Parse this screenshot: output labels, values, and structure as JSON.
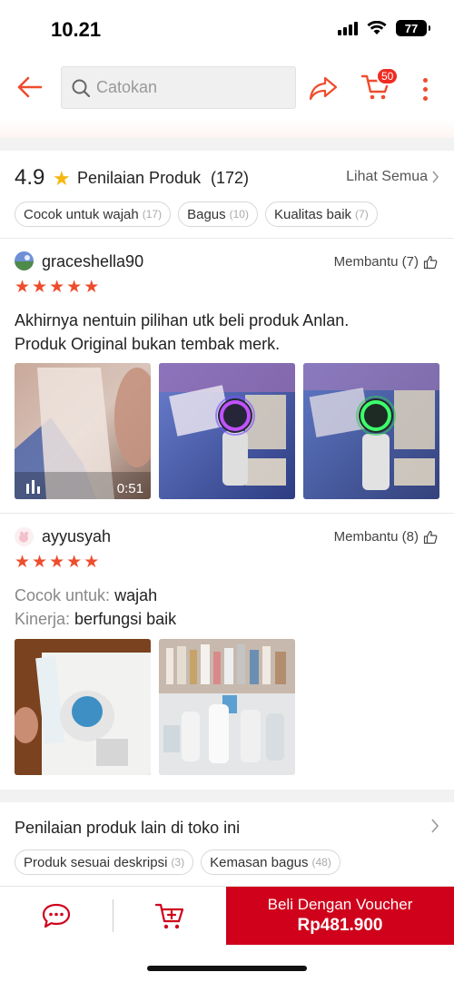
{
  "status_bar": {
    "time": "10.21",
    "battery": "77"
  },
  "header": {
    "search_placeholder": "Catokan",
    "cart_count": "50"
  },
  "colors": {
    "accent": "#ee4d2d",
    "star": "#f6b60e",
    "buy_button": "#d0011b"
  },
  "rating": {
    "score": "4.9",
    "title": "Penilaian Produk",
    "count": "(172)",
    "see_all": "Lihat Semua",
    "chips": [
      {
        "label": "Cocok untuk wajah",
        "count": "(17)"
      },
      {
        "label": "Bagus",
        "count": "(10)"
      },
      {
        "label": "Kualitas baik",
        "count": "(7)"
      }
    ]
  },
  "reviews": [
    {
      "username": "graceshella90",
      "helpful": "Membantu (7)",
      "stars": 5,
      "text_line1": "Akhirnya nentuin pilihan utk beli produk Anlan.",
      "text_line2": "Produk Original bukan tembak merk.",
      "video_duration": "0:51"
    },
    {
      "username": "ayyusyah",
      "helpful": "Membantu (8)",
      "stars": 5,
      "attr1_key": "Cocok untuk:",
      "attr1_value": "wajah",
      "attr2_key": "Kinerja:",
      "attr2_value": "berfungsi baik"
    }
  ],
  "other_reviews": {
    "title": "Penilaian produk lain di toko ini",
    "chips": [
      {
        "label": "Produk sesuai deskripsi",
        "count": "(3)"
      },
      {
        "label": "Kemasan bagus",
        "count": "(48)"
      }
    ]
  },
  "bottom_bar": {
    "buy_label": "Beli Dengan Voucher",
    "buy_price": "Rp481.900"
  }
}
